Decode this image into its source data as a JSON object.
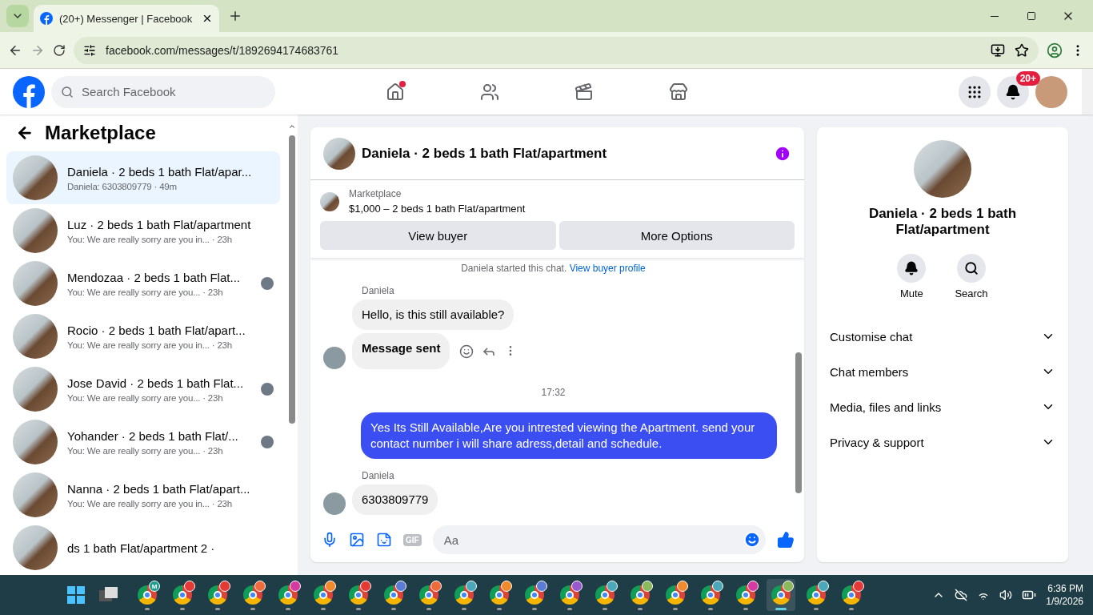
{
  "browser": {
    "tab_title": "(20+) Messenger | Facebook",
    "url": "facebook.com/messages/t/1892694174683761"
  },
  "header": {
    "search_placeholder": "Search Facebook",
    "nav": [
      {
        "kind": "home",
        "dot": true
      },
      {
        "kind": "friends",
        "dot": false
      },
      {
        "kind": "video",
        "dot": false
      },
      {
        "kind": "marketplace",
        "dot": false
      }
    ],
    "notification_badge": "20+"
  },
  "sidebar": {
    "title": "Marketplace",
    "conversations": [
      {
        "name": "Daniela · 2 beds 1 bath Flat/apar...",
        "snippet": "Daniela: 6303809779 · 49m",
        "selected": true,
        "seen": false
      },
      {
        "name": "Luz · 2 beds 1 bath Flat/apartment",
        "snippet": "You: We are really sorry are you in... · 23h",
        "selected": false,
        "seen": false
      },
      {
        "name": "Mendozaa · 2 beds 1 bath Flat...",
        "snippet": "You: We are really sorry are you... · 23h",
        "selected": false,
        "seen": true
      },
      {
        "name": "Rocio · 2 beds 1 bath Flat/apart...",
        "snippet": "You: We are really sorry are you in... · 23h",
        "selected": false,
        "seen": false
      },
      {
        "name": "Jose David · 2 beds 1 bath Flat...",
        "snippet": "You: We are really sorry are you... · 23h",
        "selected": false,
        "seen": true
      },
      {
        "name": "Yohander · 2 beds 1 bath Flat/...",
        "snippet": "You: We are really sorry are you... · 23h",
        "selected": false,
        "seen": true
      },
      {
        "name": "Nanna · 2 beds 1 bath Flat/apart...",
        "snippet": "You: We are really sorry are you in... · 23h",
        "selected": false,
        "seen": false
      },
      {
        "name": "ds 1 bath Flat/apartment 2 ·",
        "selected": false,
        "seen": false
      }
    ]
  },
  "chat": {
    "title": "Daniela · 2 beds 1 bath Flat/apartment",
    "listing": {
      "label": "Marketplace",
      "price_title": "$1,000 – 2 beds 1 bath Flat/apartment"
    },
    "buttons": [
      "View buyer",
      "More Options"
    ],
    "intro": {
      "text": "Daniela started this chat.",
      "link": "View buyer profile"
    },
    "messages": [
      {
        "kind": "sender",
        "text": "Daniela"
      },
      {
        "kind": "incoming",
        "text": "Hello, is this still available?",
        "avatar": false,
        "bold": false,
        "actions": false
      },
      {
        "kind": "incoming",
        "text": "Message sent",
        "avatar": true,
        "bold": true,
        "actions": true
      },
      {
        "kind": "time",
        "text": "17:32"
      },
      {
        "kind": "outgoing",
        "text": "Yes Its Still Available,Are you intrested viewing the Apartment. send your contact number i will share adress,detail and schedule."
      },
      {
        "kind": "sender",
        "text": "Daniela"
      },
      {
        "kind": "incoming",
        "text": "6303809779",
        "avatar": true,
        "bold": false,
        "actions": false
      }
    ],
    "composer_placeholder": "Aa",
    "gif_label": "GIF"
  },
  "details": {
    "title": "Daniela · 2 beds 1 bath Flat/apartment",
    "actions": [
      {
        "kind": "mute",
        "label": "Mute"
      },
      {
        "kind": "search",
        "label": "Search"
      }
    ],
    "sections": [
      {
        "label": "Customise chat",
        "expanded": false
      },
      {
        "label": "Chat members",
        "expanded": false
      },
      {
        "label": "Media, files and links",
        "expanded": false
      },
      {
        "label": "Privacy & support",
        "expanded": false
      }
    ]
  },
  "taskbar": {
    "apps": [
      {
        "badge": "M",
        "color": "#1e9e8e",
        "active": false
      },
      {
        "color": "#e53935",
        "active": false
      },
      {
        "color": "#e53935",
        "active": false
      },
      {
        "color": "#f06a3a",
        "active": false
      },
      {
        "color": "#d63aa0",
        "active": false
      },
      {
        "color": "#f08a2a",
        "active": false
      },
      {
        "color": "#e53935",
        "active": false
      },
      {
        "color": "#5b7bd5",
        "active": false
      },
      {
        "color": "#f06a3a",
        "active": false
      },
      {
        "color": "#4aa8b8",
        "active": false
      },
      {
        "color": "#f08a2a",
        "active": false
      },
      {
        "color": "#5b7bd5",
        "active": false
      },
      {
        "color": "#9b59d0",
        "active": false
      },
      {
        "color": "#4aa8b8",
        "active": false
      },
      {
        "color": "#8ab85a",
        "active": false
      },
      {
        "color": "#f08a2a",
        "active": false
      },
      {
        "color": "#4aa8b8",
        "active": false
      },
      {
        "color": "#d63aa0",
        "active": false
      },
      {
        "color": "#8ab85a",
        "active": true
      },
      {
        "color": "#4aa8b8",
        "active": false
      },
      {
        "color": "#e53935",
        "active": false
      }
    ],
    "time": "6:36 PM",
    "date": "1/9/2026"
  }
}
